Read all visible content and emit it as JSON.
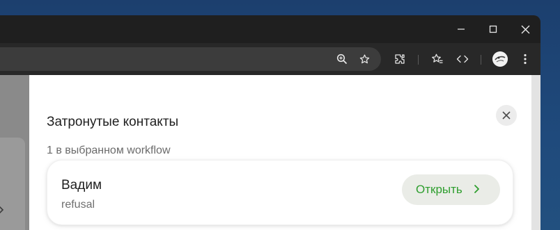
{
  "window": {
    "controls": [
      "minimize-icon",
      "maximize-icon",
      "close-icon"
    ]
  },
  "toolbar": {
    "icons": [
      "zoom-icon",
      "bookmark-star-icon",
      "extensions-icon",
      "reading-list-icon",
      "devtools-icon",
      "profile-avatar",
      "more-menu-icon"
    ]
  },
  "panel": {
    "title": "Затронутые контакты",
    "subtitle": "1 в выбранном workflow",
    "contact": {
      "name": "Вадим",
      "status": "refusal",
      "open_label": "Открыть"
    }
  },
  "colors": {
    "accent_green": "#2e9e2e",
    "button_bg": "#eaece7",
    "titlebar": "#1f1f1f",
    "toolbar": "#282828"
  }
}
